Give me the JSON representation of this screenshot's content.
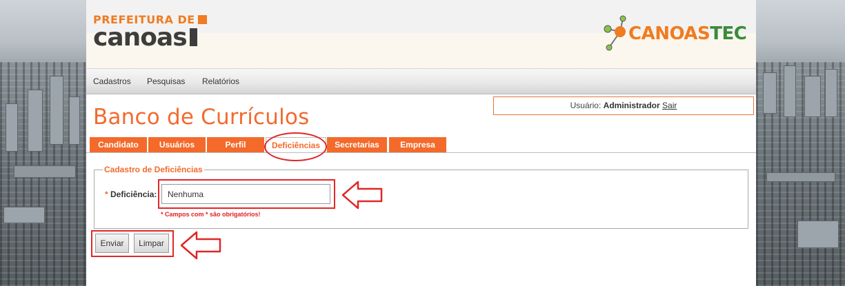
{
  "header": {
    "logo_top": "PREFEITURA DE",
    "logo_bottom": "canoas",
    "partner_logo_part1": "CANOAS",
    "partner_logo_part2": "TEC"
  },
  "menu": {
    "items": [
      {
        "label": "Cadastros"
      },
      {
        "label": "Pesquisas"
      },
      {
        "label": "Relatórios"
      }
    ]
  },
  "page_title": "Banco de Currículos",
  "user": {
    "prefix": "Usuário: ",
    "name": "Administrador",
    "logout": "Sair"
  },
  "tabs": [
    {
      "label": "Candidato"
    },
    {
      "label": "Usuários"
    },
    {
      "label": "Perfil"
    },
    {
      "label": "Deficiências"
    },
    {
      "label": "Secretarias"
    },
    {
      "label": "Empresa"
    }
  ],
  "active_tab": "Deficiências",
  "form": {
    "legend": "Cadastro de Deficiências",
    "field_required_mark": "*",
    "field_label": "Deficiência:",
    "field_value": "Nenhuma",
    "hint": "* Campos com * são obrigatórios!",
    "submit_label": "Enviar",
    "clear_label": "Limpar"
  },
  "colors": {
    "accent": "#f36a2b",
    "annotation_red": "#e02626",
    "logo_green": "#3a8a3a"
  }
}
